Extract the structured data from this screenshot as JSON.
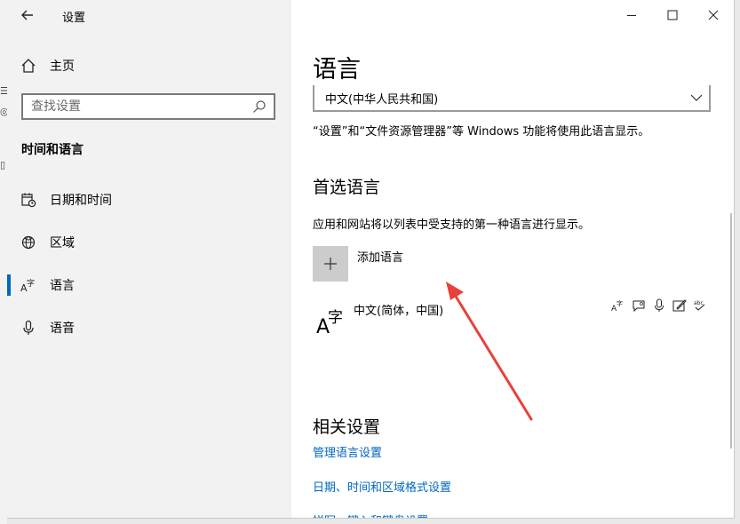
{
  "window": {
    "title": "设置"
  },
  "sidebar": {
    "home": "主页",
    "search_placeholder": "查找设置",
    "section": "时间和语言",
    "items": [
      {
        "label": "日期和时间",
        "icon": "calendar-clock-icon",
        "selected": false
      },
      {
        "label": "区域",
        "icon": "globe-icon",
        "selected": false
      },
      {
        "label": "语言",
        "icon": "language-icon",
        "selected": true
      },
      {
        "label": "语音",
        "icon": "microphone-icon",
        "selected": false
      }
    ]
  },
  "content": {
    "title": "语言",
    "display_language": "中文(中华人民共和国)",
    "display_language_desc": "“设置”和“文件资源管理器”等 Windows 功能将使用此语言显示。",
    "preferred_title": "首选语言",
    "preferred_desc": "应用和网站将以列表中受支持的第一种语言进行显示。",
    "add_language": "添加语言",
    "languages": [
      {
        "name": "中文(简体，中国)",
        "features": [
          "display-language-icon",
          "speech-bubble-icon",
          "microphone-icon",
          "handwriting-icon",
          "spellcheck-icon"
        ]
      }
    ],
    "related_title": "相关设置",
    "links": [
      "管理语言设置",
      "日期、时间和区域格式设置",
      "拼写、键入和键盘设置"
    ]
  },
  "colors": {
    "accent": "#0067c0",
    "annotation": "#e8413b",
    "sidebar_bg": "#f2f2f2"
  }
}
